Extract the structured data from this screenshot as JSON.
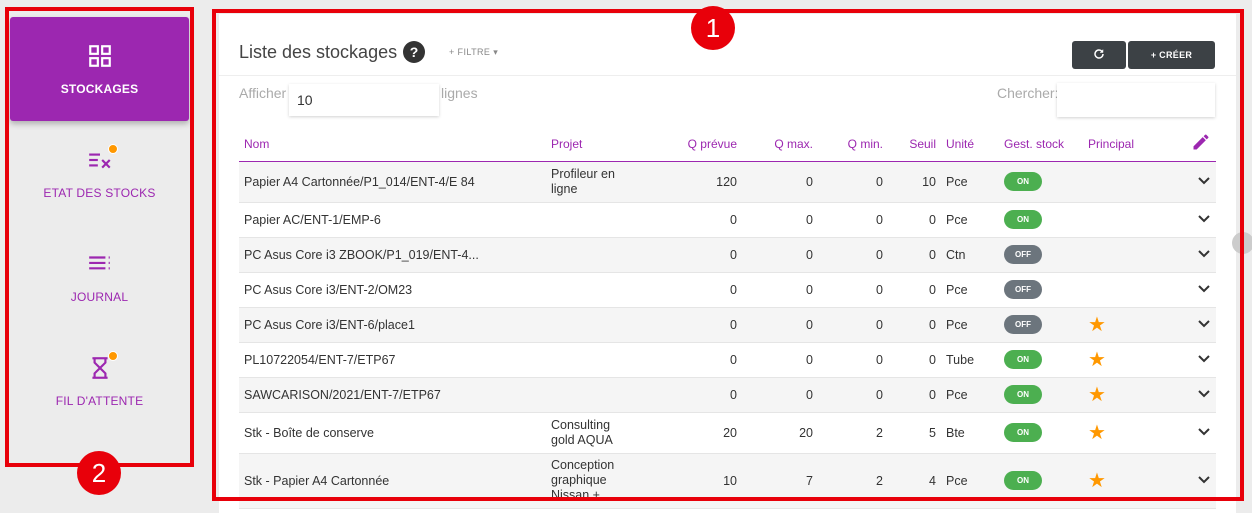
{
  "sidebar": {
    "items": [
      {
        "label": "STOCKAGES",
        "icon": "grid-icon",
        "active": true
      },
      {
        "label": "ETAT DES STOCKS",
        "icon": "list-x-icon",
        "active": false
      },
      {
        "label": "JOURNAL",
        "icon": "list-icon",
        "active": false
      },
      {
        "label": "FIL D'ATTENTE",
        "icon": "hourglass-icon",
        "active": false
      }
    ]
  },
  "header": {
    "title": "Liste des stockages",
    "help_glyph": "?",
    "filter_label": "+ FILTRE ▾",
    "create_label": "+ CRÉER"
  },
  "controls": {
    "show_label": "Afficher",
    "rows_value": "10",
    "rows_suffix": "lignes",
    "search_label": "Chercher:",
    "search_value": ""
  },
  "table": {
    "columns": [
      "Nom",
      "Projet",
      "Q prévue",
      "Q max.",
      "Q min.",
      "Seuil",
      "Unité",
      "Gest. stock",
      "Principal"
    ],
    "rows": [
      {
        "nom": "Papier A4 Cartonnée/P1_014/ENT-4/E 84",
        "projet": "Profileur en\nligne",
        "q_prevue": "120",
        "q_max": "0",
        "q_min": "0",
        "seuil": "10",
        "unite": "Pce",
        "gest": "ON",
        "principal": false
      },
      {
        "nom": "Papier AC/ENT-1/EMP-6",
        "projet": "",
        "q_prevue": "0",
        "q_max": "0",
        "q_min": "0",
        "seuil": "0",
        "unite": "Pce",
        "gest": "ON",
        "principal": false
      },
      {
        "nom": "PC Asus Core i3 ZBOOK/P1_019/ENT-4...",
        "projet": "",
        "q_prevue": "0",
        "q_max": "0",
        "q_min": "0",
        "seuil": "0",
        "unite": "Ctn",
        "gest": "OFF",
        "principal": false
      },
      {
        "nom": "PC Asus Core i3/ENT-2/OM23",
        "projet": "",
        "q_prevue": "0",
        "q_max": "0",
        "q_min": "0",
        "seuil": "0",
        "unite": "Pce",
        "gest": "OFF",
        "principal": false
      },
      {
        "nom": "PC Asus Core i3/ENT-6/place1",
        "projet": "",
        "q_prevue": "0",
        "q_max": "0",
        "q_min": "0",
        "seuil": "0",
        "unite": "Pce",
        "gest": "OFF",
        "principal": true
      },
      {
        "nom": "PL10722054/ENT-7/ETP67",
        "projet": "",
        "q_prevue": "0",
        "q_max": "0",
        "q_min": "0",
        "seuil": "0",
        "unite": "Tube",
        "gest": "ON",
        "principal": true
      },
      {
        "nom": "SAWCARISON/2021/ENT-7/ETP67",
        "projet": "",
        "q_prevue": "0",
        "q_max": "0",
        "q_min": "0",
        "seuil": "0",
        "unite": "Pce",
        "gest": "ON",
        "principal": true
      },
      {
        "nom": "Stk - Boîte de conserve",
        "projet": "Consulting\ngold AQUA",
        "q_prevue": "20",
        "q_max": "20",
        "q_min": "2",
        "seuil": "5",
        "unite": "Bte",
        "gest": "ON",
        "principal": true
      },
      {
        "nom": "Stk - Papier A4 Cartonnée",
        "projet": "Conception\ngraphique\nNissan +",
        "q_prevue": "10",
        "q_max": "7",
        "q_min": "2",
        "seuil": "4",
        "unite": "Pce",
        "gest": "ON",
        "principal": true
      }
    ]
  },
  "annotations": [
    {
      "number": "1"
    },
    {
      "number": "2"
    }
  ],
  "colors": {
    "accent": "#9c27b0",
    "annotation": "#e8000a",
    "toggle_on": "#4caf50",
    "toggle_off": "#6c757d",
    "star": "#ff9800",
    "button_dark": "#3c4145"
  }
}
